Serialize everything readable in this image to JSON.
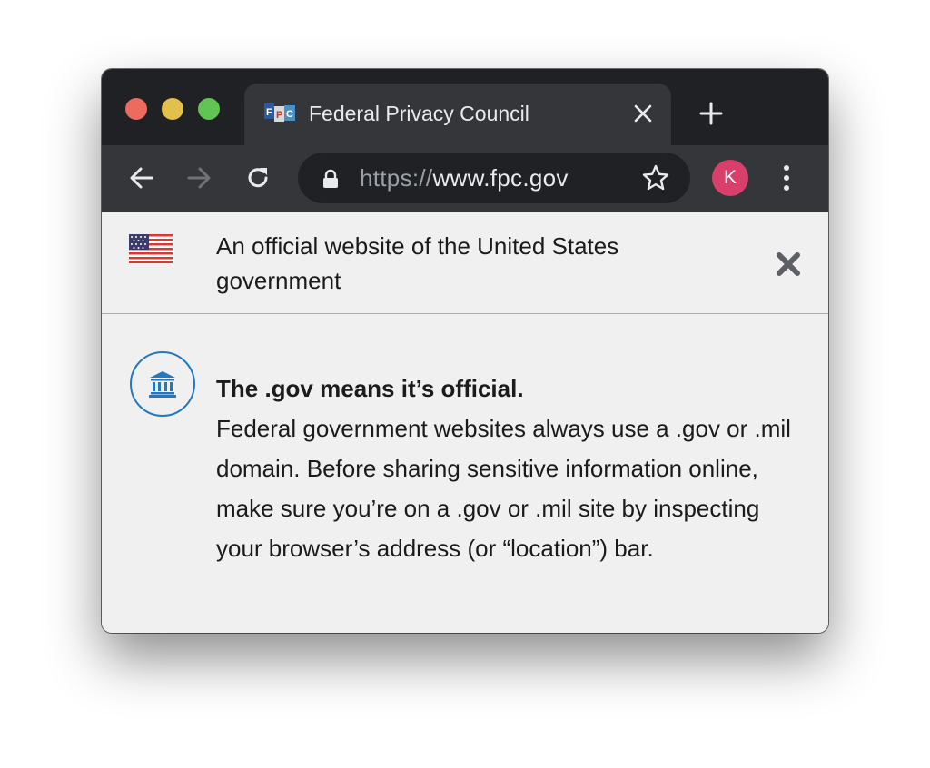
{
  "browser": {
    "tab": {
      "favicon": "fpc-favicon",
      "title": "Federal Privacy Council",
      "close_icon": "close-icon"
    },
    "new_tab_icon": "plus-icon",
    "toolbar": {
      "back_icon": "arrow-left-icon",
      "forward_icon": "arrow-right-icon",
      "reload_icon": "reload-icon",
      "address": {
        "lock_icon": "lock-icon",
        "scheme": "https://",
        "host": "www.fpc.gov",
        "star_icon": "star-outline-icon"
      },
      "profile_initial": "K",
      "menu_icon": "vertical-dots-icon"
    },
    "colors": {
      "titlebar": "#202124",
      "toolbar": "#35363a",
      "profile": "#d8406b"
    }
  },
  "gov_banner": {
    "flag_icon": "us-flag-icon",
    "text": "An official website of the United States government",
    "close_icon": "close-x-icon"
  },
  "official_info": {
    "icon": "government-building-icon",
    "heading": "The .gov means it’s official.",
    "body": "Federal government websites always use a .gov or .mil domain. Before sharing sensitive information online, make sure you’re on a .gov or .mil site by inspecting your browser’s address (or “location”) bar.",
    "accent_color": "#2378c3"
  }
}
